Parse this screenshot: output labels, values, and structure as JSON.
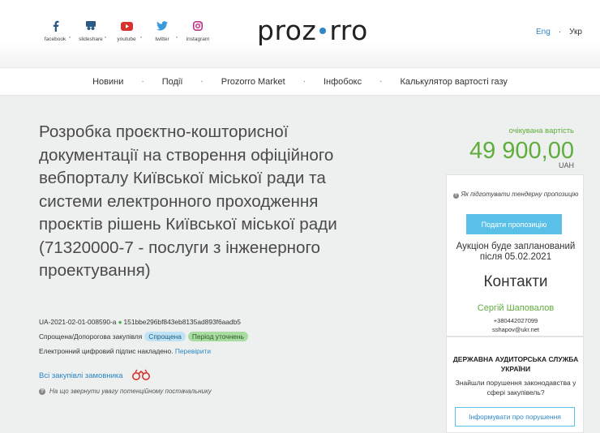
{
  "header": {
    "social": [
      {
        "label": "facebook",
        "icon": "facebook-icon"
      },
      {
        "label": "slideshare",
        "icon": "slideshare-icon"
      },
      {
        "label": "youtube",
        "icon": "youtube-icon"
      },
      {
        "label": "twitter",
        "icon": "twitter-icon"
      },
      {
        "label": "instagram",
        "icon": "instagram-icon"
      }
    ],
    "logo_left": "proz",
    "logo_right": "rro",
    "lang_eng": "Eng",
    "lang_sep": "·",
    "lang_ukr": "Укр"
  },
  "nav": {
    "items": [
      "Новини",
      "Події",
      "Prozorro Market",
      "Інфобокс",
      "Калькулятор вартості газу"
    ],
    "separator": "·"
  },
  "tender": {
    "title": "Розробка проєктно-кошторисної документації на створення офіційного вебпорталу Київської міської ради та системи електронного проходження проєктів рішень Київської міської ради (71320000-7 - послуги з інженерного проектування)",
    "id": "UA-2021-02-01-008590-a",
    "hash": "151bbe296bf843eb8135ad893f6aadb5",
    "procedure": "Спрощена/Допорогова закупівля",
    "badge_simplified": "Спрощена",
    "badge_period": "Період уточнень",
    "signature_text": "Електронний цифровий підпис накладено.",
    "signature_link": "Перевірити",
    "buyer_link": "Всі закупівлі замовника",
    "hint": "На що звернути увагу потенційному постачальнику"
  },
  "value": {
    "label": "очікувана вартість",
    "amount": "49 900,00",
    "currency": "UAH"
  },
  "panel": {
    "how_to": "Як підготувати тендерну пропозицію",
    "offer_button": "Подати пропозицію",
    "auction_text": "Аукціон буде запланований після 05.02.2021",
    "contacts_title": "Контакти",
    "contact_name": "Сергій Шаповалов",
    "contact_phone": "+380442027099",
    "contact_email": "sshapov@ukr.net"
  },
  "audit": {
    "title": "ДЕРЖАВНА АУДИТОРСЬКА СЛУЖБА УКРАЇНИ",
    "text": "Знайшли порушення законодавства у сфері закупівель?",
    "button": "Інформувати про порушення"
  },
  "colors": {
    "accent": "#2d86c7",
    "green": "#5fae3c",
    "button": "#5bc0e8",
    "main_bg": "#edf0ee"
  }
}
